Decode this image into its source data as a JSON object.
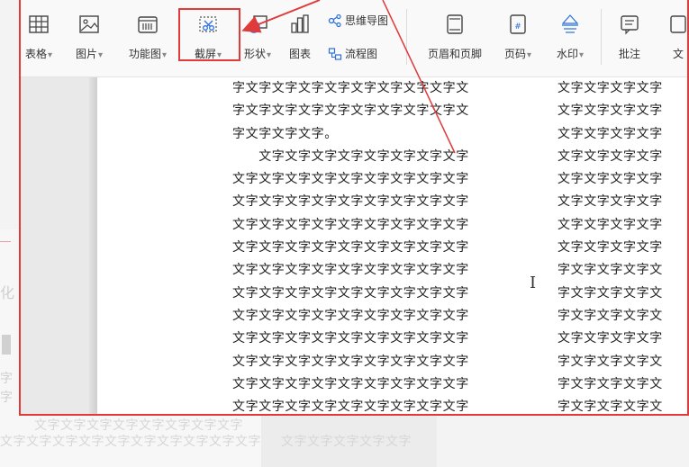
{
  "ribbon": {
    "table_label": "表格",
    "image_label": "图片",
    "function_chart_label": "功能图",
    "screenshot_label": "截屏",
    "shape_label": "形状",
    "chart_label": "图表",
    "mindmap_label": "思维导图",
    "flowchart_label": "流程图",
    "header_footer_label": "页眉和页脚",
    "page_number_label": "页码",
    "watermark_label": "水印",
    "comment_label": "批注",
    "text_label": "文"
  },
  "document": {
    "col1_lines": [
      "字文字文字文字文字文字文字文字文字文",
      "字文字文字文字文字文字文字文字文字文",
      "字文字文字文字。",
      "　　文字文字文字文字文字文字文字文字",
      "文字文字文字文字文字文字文字文字文字",
      "文字文字文字文字文字文字文字文字文字",
      "文字文字文字文字文字文字文字文字文字",
      "文字文字文字文字文字文字文字文字文字",
      "文字文字文字文字文字文字文字文字文字",
      "文字文字文字文字文字文字文字文字文字",
      "文字文字文字文字文字文字文字文字文字",
      "文字文字文字文字文字文字文字文字文字",
      "文字文字文字文字文字文字文字文字文字",
      "文字文字文字文字文字文字文字文字文字",
      "文字文字文字文字文字文字文字文字文字"
    ],
    "col2_lines": [
      "文字文字文字文字",
      "文字文字文字文字",
      "文字文字文字文字",
      "文字文字文字文字",
      "文字文字文字文字",
      "文字文字文字文字",
      "文字文字文字文字",
      "文字文字文字文字",
      "字文字文字文字文",
      "字文字文字文字文",
      "字文字文字文字文",
      "文字文字文字文字",
      "字文字文字文字文",
      "字文字文字文字文",
      "字文字文字文字文"
    ]
  },
  "background": {
    "line1": "文字文字文字文字文字文字文字文字",
    "line2": "文字文字文字文字文字文字文字文字文字文字",
    "line3": "文字文字文字文字文字",
    "side1": "化",
    "side3": "字",
    "side4": "字"
  },
  "colors": {
    "highlight": "#e03a3a",
    "arrow": "#e03a3a"
  }
}
